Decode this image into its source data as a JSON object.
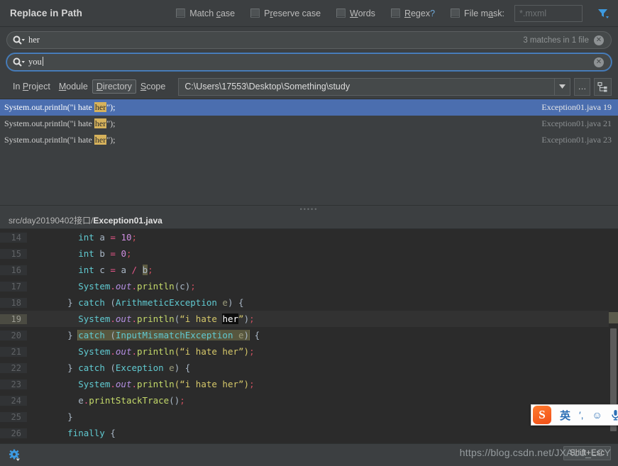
{
  "window": {
    "title": "Replace in Path"
  },
  "options": [
    {
      "name": "match-case",
      "label_pre": "Match ",
      "label_u": "c",
      "label_post": "ase",
      "checked": false
    },
    {
      "name": "preserve-case",
      "label_pre": "P",
      "label_u": "r",
      "label_post": "eserve case",
      "checked": false
    },
    {
      "name": "words",
      "label_pre": "",
      "label_u": "W",
      "label_post": "ords",
      "checked": false
    },
    {
      "name": "regex",
      "label_pre": "",
      "label_u": "R",
      "label_post": "egex",
      "checked": false
    }
  ],
  "file_mask": {
    "checked": false,
    "label": "File m",
    "label_u": "a",
    "label_post": "sk:",
    "placeholder": "*.mxml",
    "value": ""
  },
  "search": {
    "icon": "search-icon",
    "value": "her",
    "match_count": "3 matches in 1 file",
    "clear": "✕"
  },
  "replace": {
    "icon": "search-icon",
    "value": "you",
    "clear": "✕"
  },
  "scope": {
    "options": [
      {
        "key": "in-project",
        "pre": "In ",
        "u": "P",
        "post": "roject",
        "selected": false
      },
      {
        "key": "module",
        "pre": "",
        "u": "M",
        "post": "odule",
        "selected": false
      },
      {
        "key": "directory",
        "pre": "",
        "u": "D",
        "post": "irectory",
        "selected": true
      },
      {
        "key": "scope",
        "pre": "",
        "u": "S",
        "post": "cope",
        "selected": false
      }
    ],
    "path": "C:\\Users\\17553\\Desktop\\Something\\study",
    "dropdown_glyph": "▼",
    "ellipsis_label": "…",
    "tree_icon": "project-tree-icon"
  },
  "results": [
    {
      "pre": "System.out.println(\"i hate ",
      "hit": "her",
      "post": "\");",
      "file": "Exception01.java",
      "line": "19",
      "selected": true
    },
    {
      "pre": "System.out.println(\"i hate ",
      "hit": "her",
      "post": "\");",
      "file": "Exception01.java",
      "line": "21",
      "selected": false
    },
    {
      "pre": "System.out.println(\"i hate ",
      "hit": "her",
      "post": "\");",
      "file": "Exception01.java",
      "line": "23",
      "selected": false
    }
  ],
  "preview": {
    "breadcrumb_dir": "src/day20190402接口/",
    "breadcrumb_file": "Exception01.java",
    "lines": [
      {
        "no": "14",
        "current": false
      },
      {
        "no": "15",
        "current": false
      },
      {
        "no": "16",
        "current": false
      },
      {
        "no": "17",
        "current": false
      },
      {
        "no": "18",
        "current": false
      },
      {
        "no": "19",
        "current": true
      },
      {
        "no": "20",
        "current": false
      },
      {
        "no": "21",
        "current": false
      },
      {
        "no": "22",
        "current": false
      },
      {
        "no": "23",
        "current": false
      },
      {
        "no": "24",
        "current": false
      },
      {
        "no": "25",
        "current": false
      },
      {
        "no": "26",
        "current": false
      }
    ],
    "code": {
      "l14": {
        "kw": "int",
        "var": " a ",
        "op": "= ",
        "num": "10",
        "semi": ";"
      },
      "l15": {
        "kw": "int",
        "var": " b ",
        "op": "= ",
        "num": "0",
        "semi": ";"
      },
      "l16": {
        "kw": "int",
        "var": " c ",
        "op": "= ",
        "a": "a ",
        "slash": "/ ",
        "b": "b",
        "semi": ";"
      },
      "l17": {
        "sys": "System",
        "dot1": ".",
        "out": "out",
        "dot2": ".",
        "meth": "println",
        "args": "(c)",
        "semi": ";"
      },
      "l18": {
        "brace": "} ",
        "catch": "catch ",
        "paren1": "(",
        "type": "ArithmeticException",
        "param": " e",
        "paren2": ") ",
        "brace2": "{"
      },
      "l19": {
        "sys": "System",
        "dot1": ".",
        "out": "out",
        "dot2": ".",
        "meth": "println",
        "paren": "(",
        "str1": "“i hate ",
        "hit": "her",
        "str2": "”",
        "paren2": ")",
        "semi": ";"
      },
      "l20": {
        "brace": "} ",
        "catch": "catch ",
        "paren1": "(",
        "type": "InputMismatchException",
        "param": " e",
        "paren2": ")",
        "brace2": " {"
      },
      "l21": {
        "sys": "System",
        "dot1": ".",
        "out": "out",
        "dot2": ".",
        "meth": "println",
        "args": "(“i hate her”)",
        "semi": ";"
      },
      "l22": {
        "brace": "} ",
        "catch": "catch ",
        "paren1": "(",
        "type": "Exception",
        "param": " e",
        "paren2": ") ",
        "brace2": "{"
      },
      "l23": {
        "sys": "System",
        "dot1": ".",
        "out": "out",
        "dot2": ".",
        "meth": "println",
        "args": "(“i hate her”)",
        "semi": ";"
      },
      "l24": {
        "e": "e",
        "dot": ".",
        "meth": "printStackTrace",
        "args": "()",
        "semi": ";"
      },
      "l25": {
        "brace": "}"
      },
      "l26": {
        "kw": "finally",
        "brace": " {"
      }
    }
  },
  "statusbar": {
    "settings_icon": "gear-icon",
    "tooltip": "Shift+Esc",
    "watermark": "https://blog.csdn.net/JXAUJ_LCY"
  },
  "ime": {
    "logo": "S",
    "mode": "英",
    "punct": "′,",
    "emoji": "☺",
    "mic": "mic-icon"
  },
  "colors": {
    "accent_blue": "#4b6eaf",
    "panel_bg": "#3c3f41",
    "editor_bg": "#2b2b2b",
    "highlight_yellow": "#d6b25c",
    "focus_border": "#4d86c9"
  }
}
